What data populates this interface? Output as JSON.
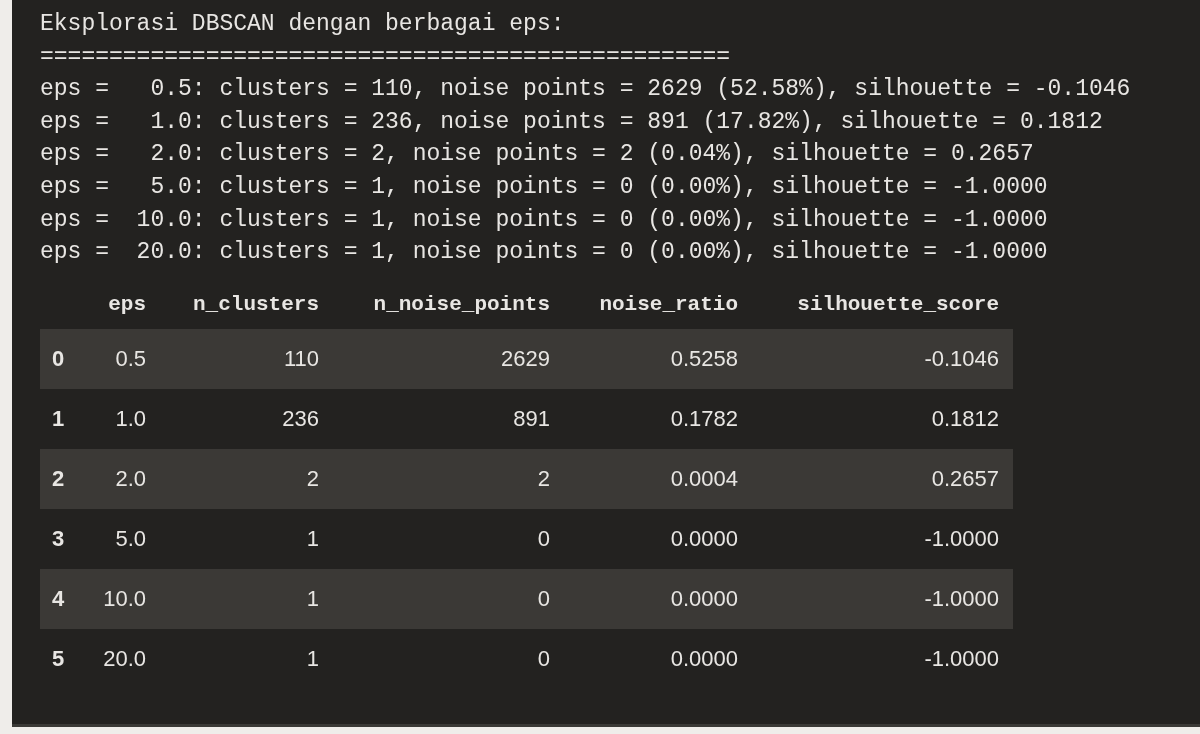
{
  "output_lines": [
    "Eksplorasi DBSCAN dengan berbagai eps:",
    "==================================================",
    "eps =   0.5: clusters = 110, noise points = 2629 (52.58%), silhouette = -0.1046",
    "eps =   1.0: clusters = 236, noise points = 891 (17.82%), silhouette = 0.1812",
    "eps =   2.0: clusters = 2, noise points = 2 (0.04%), silhouette = 0.2657",
    "eps =   5.0: clusters = 1, noise points = 0 (0.00%), silhouette = -1.0000",
    "eps =  10.0: clusters = 1, noise points = 0 (0.00%), silhouette = -1.0000",
    "eps =  20.0: clusters = 1, noise points = 0 (0.00%), silhouette = -1.0000"
  ],
  "table": {
    "columns": [
      "eps",
      "n_clusters",
      "n_noise_points",
      "noise_ratio",
      "silhouette_score"
    ],
    "rows": [
      {
        "index": "0",
        "cells": [
          "0.5",
          "110",
          "2629",
          "0.5258",
          "-0.1046"
        ]
      },
      {
        "index": "1",
        "cells": [
          "1.0",
          "236",
          "891",
          "0.1782",
          "0.1812"
        ]
      },
      {
        "index": "2",
        "cells": [
          "2.0",
          "2",
          "2",
          "0.0004",
          "0.2657"
        ]
      },
      {
        "index": "3",
        "cells": [
          "5.0",
          "1",
          "0",
          "0.0000",
          "-1.0000"
        ]
      },
      {
        "index": "4",
        "cells": [
          "10.0",
          "1",
          "0",
          "0.0000",
          "-1.0000"
        ]
      },
      {
        "index": "5",
        "cells": [
          "20.0",
          "1",
          "0",
          "0.0000",
          "-1.0000"
        ]
      }
    ]
  }
}
